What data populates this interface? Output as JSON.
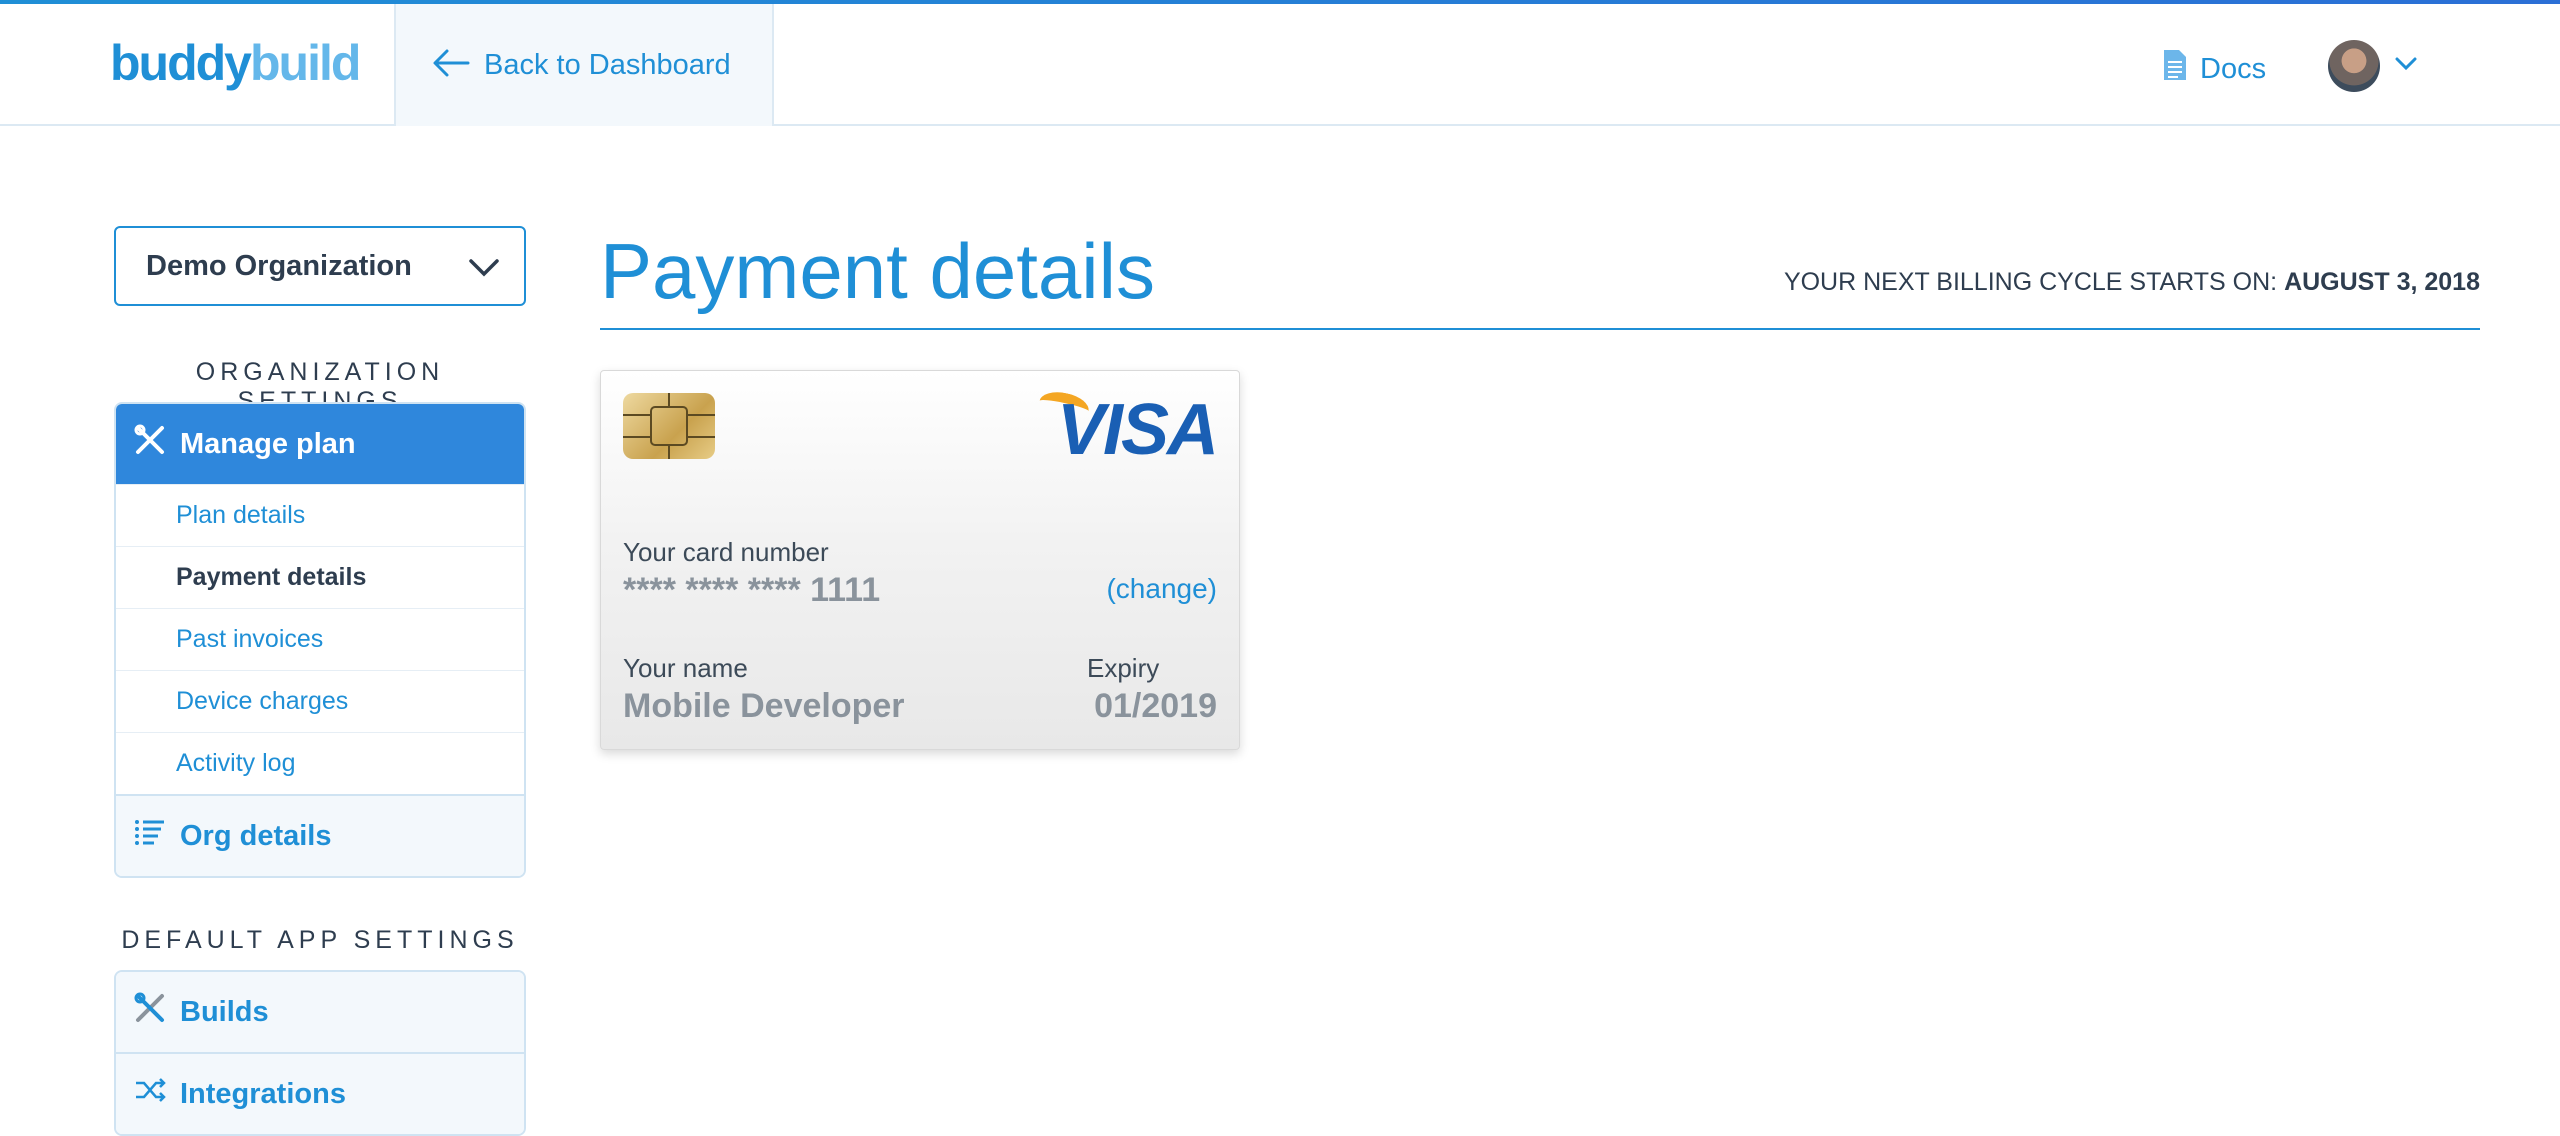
{
  "header": {
    "logo_part1": "buddy",
    "logo_part2": "build",
    "back_label": "Back to Dashboard",
    "docs_label": "Docs",
    "colors": {
      "accent": "#1f8fd6",
      "accent_light": "#64b7ea"
    }
  },
  "sidebar": {
    "org_selector": "Demo Organization",
    "org_settings_title": "ORGANIZATION SETTINGS",
    "manage_plan": "Manage plan",
    "sub_items": [
      "Plan details",
      "Payment details",
      "Past invoices",
      "Device charges",
      "Activity log"
    ],
    "current_sub": "Payment details",
    "org_details": "Org details",
    "app_settings_title": "DEFAULT APP SETTINGS",
    "builds": "Builds",
    "integrations": "Integrations"
  },
  "main": {
    "title": "Payment details",
    "billing_prefix": "YOUR NEXT BILLING CYCLE STARTS ON:",
    "billing_date": "AUGUST 3, 2018"
  },
  "card": {
    "brand": "VISA",
    "number_label": "Your card number",
    "number": "**** **** **** 1111",
    "change_label": "(change)",
    "name_label": "Your name",
    "name": "Mobile Developer",
    "expiry_label": "Expiry",
    "expiry": "01/2019"
  }
}
